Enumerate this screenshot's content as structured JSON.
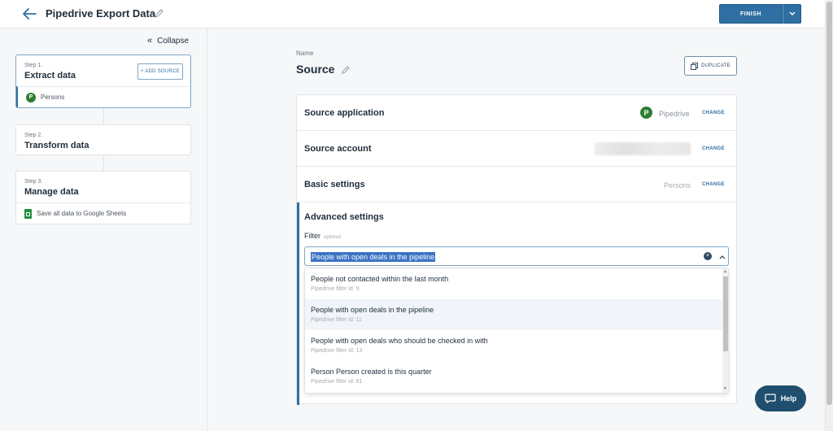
{
  "header": {
    "title": "Pipedrive Export Data",
    "finish_label": "FINISH"
  },
  "sidebar": {
    "collapse_label": "Collapse",
    "steps": [
      {
        "label": "Step 1.",
        "name": "Extract data",
        "add_label": "+ ADD SOURCE",
        "sub": "Persons"
      },
      {
        "label": "Step 2.",
        "name": "Transform data"
      },
      {
        "label": "Step 3.",
        "name": "Manage data",
        "sub": "Save all data to Google Sheets"
      }
    ]
  },
  "main": {
    "name_label": "Name",
    "title": "Source",
    "duplicate_label": "DUPLICATE",
    "change_label": "CHANGE",
    "rows": {
      "source_app": {
        "title": "Source application",
        "value": "Pipedrive",
        "logo": "P"
      },
      "source_account": {
        "title": "Source account"
      },
      "basic": {
        "title": "Basic settings",
        "value": "Persons"
      }
    },
    "advanced": {
      "title": "Advanced settings",
      "filter_label": "Filter",
      "filter_optional": "optional",
      "filter_value": "People with open deals in the pipeline",
      "options": [
        {
          "title": "People not contacted within the last month",
          "sub": "Pipedrive filter id: 9"
        },
        {
          "title": "People with open deals in the pipeline",
          "sub": "Pipedrive filter id: 11"
        },
        {
          "title": "People with open deals who should be checked in with",
          "sub": "Pipedrive filter id: 13"
        },
        {
          "title": "Person Person created is this quarter",
          "sub": "Pipedrive filter id: 91"
        }
      ]
    }
  },
  "help_label": "Help",
  "colors": {
    "accent": "#2f6fa3",
    "pipedrive": "#2e7d32",
    "sheets": "#1e8e3e"
  }
}
